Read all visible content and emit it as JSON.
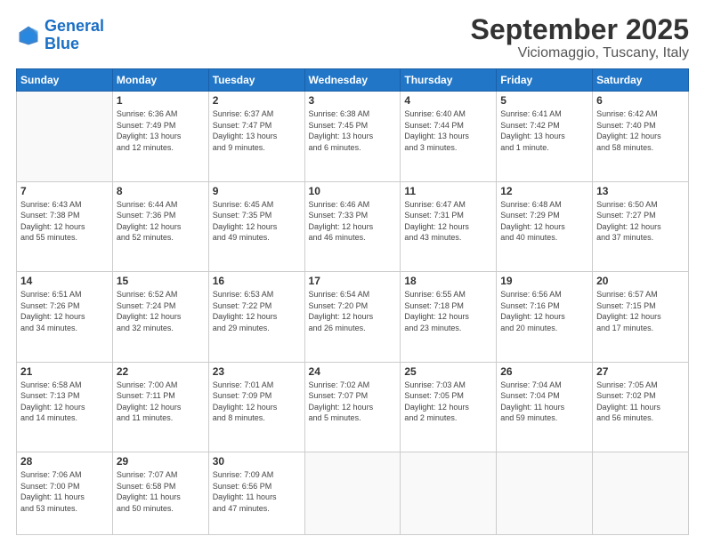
{
  "logo": {
    "line1": "General",
    "line2": "Blue"
  },
  "title": "September 2025",
  "subtitle": "Viciomaggio, Tuscany, Italy",
  "header": {
    "days": [
      "Sunday",
      "Monday",
      "Tuesday",
      "Wednesday",
      "Thursday",
      "Friday",
      "Saturday"
    ]
  },
  "weeks": [
    [
      {
        "day": "",
        "info": ""
      },
      {
        "day": "1",
        "info": "Sunrise: 6:36 AM\nSunset: 7:49 PM\nDaylight: 13 hours\nand 12 minutes."
      },
      {
        "day": "2",
        "info": "Sunrise: 6:37 AM\nSunset: 7:47 PM\nDaylight: 13 hours\nand 9 minutes."
      },
      {
        "day": "3",
        "info": "Sunrise: 6:38 AM\nSunset: 7:45 PM\nDaylight: 13 hours\nand 6 minutes."
      },
      {
        "day": "4",
        "info": "Sunrise: 6:40 AM\nSunset: 7:44 PM\nDaylight: 13 hours\nand 3 minutes."
      },
      {
        "day": "5",
        "info": "Sunrise: 6:41 AM\nSunset: 7:42 PM\nDaylight: 13 hours\nand 1 minute."
      },
      {
        "day": "6",
        "info": "Sunrise: 6:42 AM\nSunset: 7:40 PM\nDaylight: 12 hours\nand 58 minutes."
      }
    ],
    [
      {
        "day": "7",
        "info": "Sunrise: 6:43 AM\nSunset: 7:38 PM\nDaylight: 12 hours\nand 55 minutes."
      },
      {
        "day": "8",
        "info": "Sunrise: 6:44 AM\nSunset: 7:36 PM\nDaylight: 12 hours\nand 52 minutes."
      },
      {
        "day": "9",
        "info": "Sunrise: 6:45 AM\nSunset: 7:35 PM\nDaylight: 12 hours\nand 49 minutes."
      },
      {
        "day": "10",
        "info": "Sunrise: 6:46 AM\nSunset: 7:33 PM\nDaylight: 12 hours\nand 46 minutes."
      },
      {
        "day": "11",
        "info": "Sunrise: 6:47 AM\nSunset: 7:31 PM\nDaylight: 12 hours\nand 43 minutes."
      },
      {
        "day": "12",
        "info": "Sunrise: 6:48 AM\nSunset: 7:29 PM\nDaylight: 12 hours\nand 40 minutes."
      },
      {
        "day": "13",
        "info": "Sunrise: 6:50 AM\nSunset: 7:27 PM\nDaylight: 12 hours\nand 37 minutes."
      }
    ],
    [
      {
        "day": "14",
        "info": "Sunrise: 6:51 AM\nSunset: 7:26 PM\nDaylight: 12 hours\nand 34 minutes."
      },
      {
        "day": "15",
        "info": "Sunrise: 6:52 AM\nSunset: 7:24 PM\nDaylight: 12 hours\nand 32 minutes."
      },
      {
        "day": "16",
        "info": "Sunrise: 6:53 AM\nSunset: 7:22 PM\nDaylight: 12 hours\nand 29 minutes."
      },
      {
        "day": "17",
        "info": "Sunrise: 6:54 AM\nSunset: 7:20 PM\nDaylight: 12 hours\nand 26 minutes."
      },
      {
        "day": "18",
        "info": "Sunrise: 6:55 AM\nSunset: 7:18 PM\nDaylight: 12 hours\nand 23 minutes."
      },
      {
        "day": "19",
        "info": "Sunrise: 6:56 AM\nSunset: 7:16 PM\nDaylight: 12 hours\nand 20 minutes."
      },
      {
        "day": "20",
        "info": "Sunrise: 6:57 AM\nSunset: 7:15 PM\nDaylight: 12 hours\nand 17 minutes."
      }
    ],
    [
      {
        "day": "21",
        "info": "Sunrise: 6:58 AM\nSunset: 7:13 PM\nDaylight: 12 hours\nand 14 minutes."
      },
      {
        "day": "22",
        "info": "Sunrise: 7:00 AM\nSunset: 7:11 PM\nDaylight: 12 hours\nand 11 minutes."
      },
      {
        "day": "23",
        "info": "Sunrise: 7:01 AM\nSunset: 7:09 PM\nDaylight: 12 hours\nand 8 minutes."
      },
      {
        "day": "24",
        "info": "Sunrise: 7:02 AM\nSunset: 7:07 PM\nDaylight: 12 hours\nand 5 minutes."
      },
      {
        "day": "25",
        "info": "Sunrise: 7:03 AM\nSunset: 7:05 PM\nDaylight: 12 hours\nand 2 minutes."
      },
      {
        "day": "26",
        "info": "Sunrise: 7:04 AM\nSunset: 7:04 PM\nDaylight: 11 hours\nand 59 minutes."
      },
      {
        "day": "27",
        "info": "Sunrise: 7:05 AM\nSunset: 7:02 PM\nDaylight: 11 hours\nand 56 minutes."
      }
    ],
    [
      {
        "day": "28",
        "info": "Sunrise: 7:06 AM\nSunset: 7:00 PM\nDaylight: 11 hours\nand 53 minutes."
      },
      {
        "day": "29",
        "info": "Sunrise: 7:07 AM\nSunset: 6:58 PM\nDaylight: 11 hours\nand 50 minutes."
      },
      {
        "day": "30",
        "info": "Sunrise: 7:09 AM\nSunset: 6:56 PM\nDaylight: 11 hours\nand 47 minutes."
      },
      {
        "day": "",
        "info": ""
      },
      {
        "day": "",
        "info": ""
      },
      {
        "day": "",
        "info": ""
      },
      {
        "day": "",
        "info": ""
      }
    ]
  ]
}
